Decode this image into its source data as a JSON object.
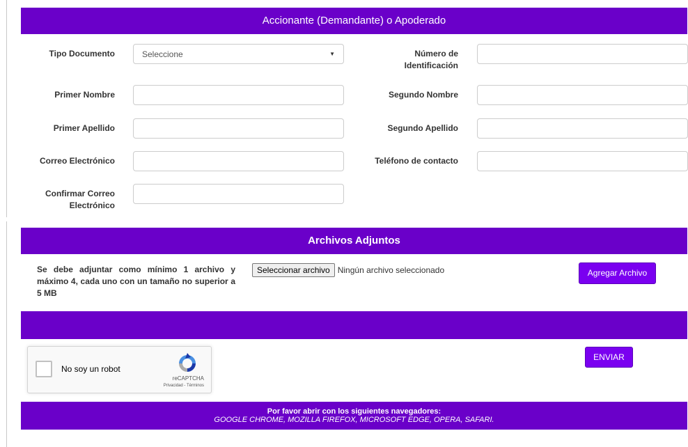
{
  "sections": {
    "applicant_title": "Accionante (Demandante) o Apoderado",
    "attachments_title": "Archivos Adjuntos"
  },
  "form": {
    "doc_type_label": "Tipo Documento",
    "doc_type_value": "Seleccione",
    "id_number_label_line1": "Número de",
    "id_number_label_line2": "Identificación",
    "first_name_label": "Primer Nombre",
    "second_name_label": "Segundo Nombre",
    "first_surname_label": "Primer Apellido",
    "second_surname_label": "Segundo Apellido",
    "email_label": "Correo Electrónico",
    "phone_label": "Teléfono de contacto",
    "confirm_email_label_line1": "Confirmar Correo",
    "confirm_email_label_line2": "Electrónico"
  },
  "attachments": {
    "note": "Se debe adjuntar como mínimo 1 archivo y máximo 4, cada uno con un tamaño no superior a 5 MB",
    "choose_file_label": "Seleccionar archivo",
    "file_status": "Ningún archivo seleccionado",
    "add_file_label": "Agregar Archivo"
  },
  "recaptcha": {
    "label": "No soy un robot",
    "brand": "reCAPTCHA",
    "terms": "Privacidad - Términos"
  },
  "send_label": "ENVIAR",
  "footer": {
    "line1": "Por favor abrir con los siguientes navegadores:",
    "line2": "GOOGLE CHROME, MOZILLA FIREFOX, MICROSOFT EDGE, OPERA, SAFARI."
  },
  "colors": {
    "primary": "#6a00c9",
    "button": "#7a00f0"
  }
}
